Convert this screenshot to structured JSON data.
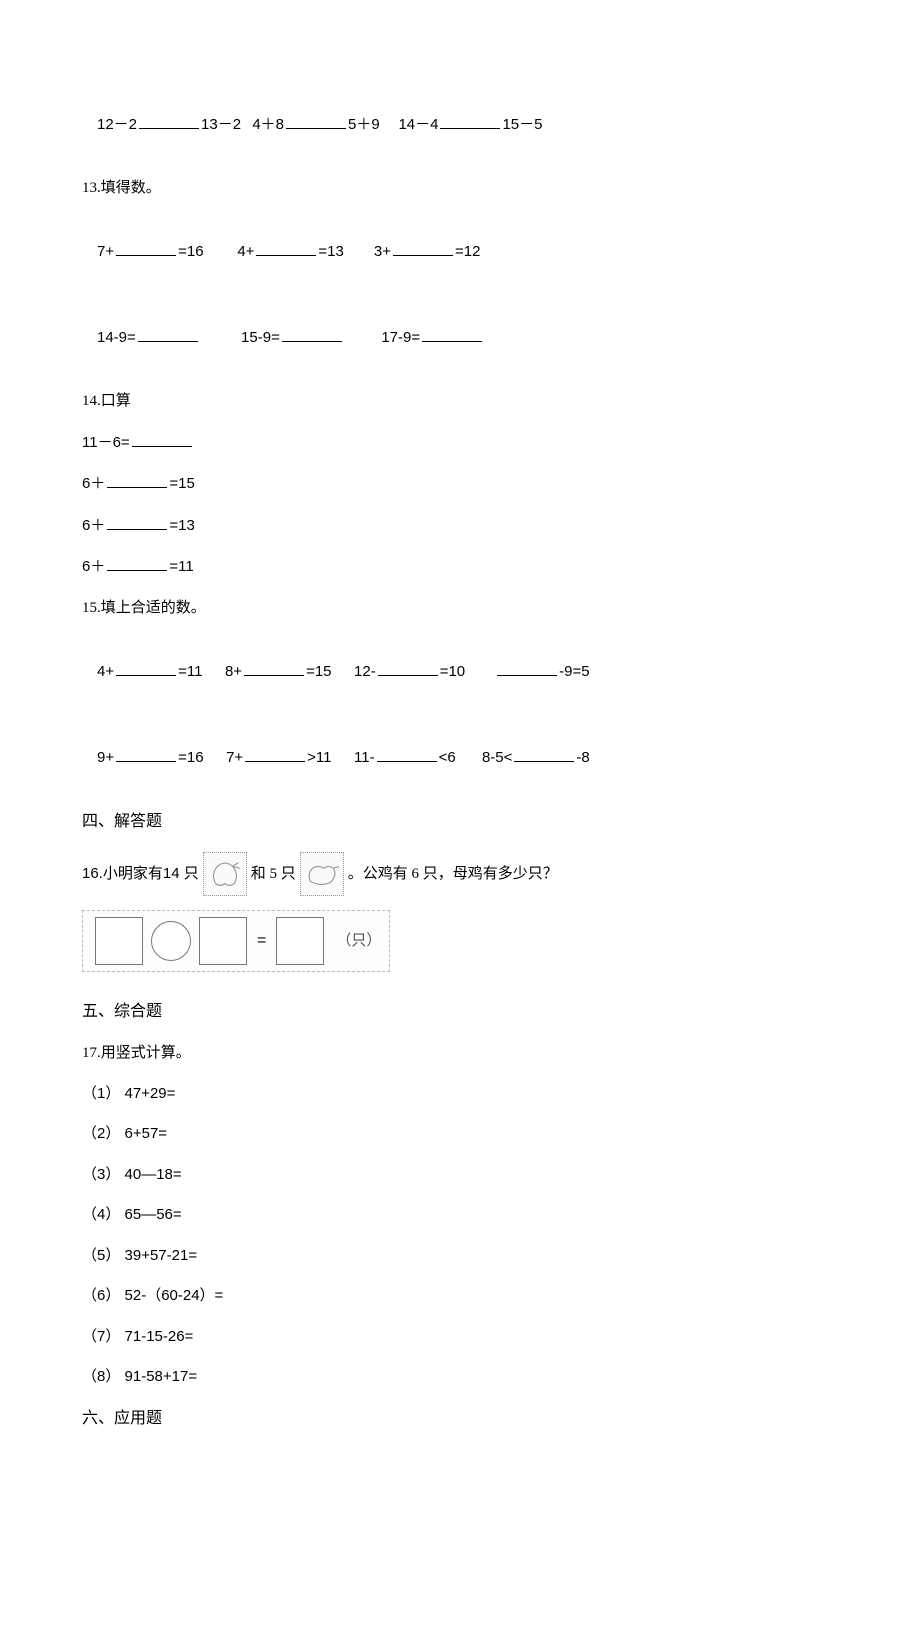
{
  "q12": {
    "part1_left": "12－2",
    "part1_right": "13－2",
    "part2_left": "4＋8",
    "part2_right": "5＋9",
    "part3_left": "14－4",
    "part3_right": "15－5"
  },
  "q13": {
    "label": "13.填得数。",
    "row1": {
      "a": "7+",
      "a_eq": "=16",
      "b": "4+",
      "b_eq": "=13",
      "c": "3+",
      "c_eq": "=12"
    },
    "row2": {
      "a": "14-9=",
      "b": "15-9=",
      "c": "17-9="
    }
  },
  "q14": {
    "label": "14.口算",
    "l1": "11－6=",
    "l2a": "6＋",
    "l2b": "=15",
    "l3a": "6＋",
    "l3b": "=13",
    "l4a": "6＋",
    "l4b": "=11"
  },
  "q15": {
    "label": "15.填上合适的数。",
    "r1": {
      "a1": "4+",
      "a2": "=11",
      "b1": "8+",
      "b2": "=15",
      "c1": "12-",
      "c2": "=10",
      "d2": "-9=5"
    },
    "r2": {
      "a1": "9+",
      "a2": "=16",
      "b1": "7+",
      "b2": ">11",
      "c1": "11-",
      "c2": "<6",
      "d1": "8-5<",
      "d2": "-8"
    }
  },
  "section4": "四、解答题",
  "q16": {
    "prefix": "16.小明家有",
    "count1": " 14 只 ",
    "mid": "和 5 只 ",
    "suffix": "。公鸡有  6 只，母鸡有多少只？",
    "unit": "（只）",
    "eq": "="
  },
  "section5": "五、综合题",
  "q17": {
    "label": "17.用竖式计算。",
    "items": [
      "（1） 47+29=",
      "（2） 6+57=",
      "（3） 40―18=",
      "（4） 65―56=",
      "（5） 39+57-21=",
      "（6） 52-（60-24）=",
      "（7） 71-15-26=",
      "（8） 91-58+17="
    ]
  },
  "section6": "六、应用题"
}
